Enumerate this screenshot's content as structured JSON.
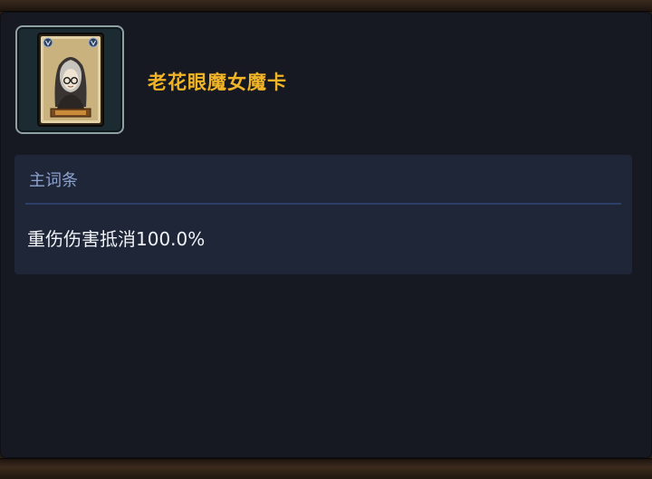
{
  "item": {
    "name": "老花眼魔女魔卡",
    "icon": "witch-card-icon",
    "rarity_border_color": "#8fa0a3",
    "name_color": "#f1b426"
  },
  "affix": {
    "title": "主词条",
    "lines": [
      "重伤伤害抵消100.0%"
    ]
  }
}
